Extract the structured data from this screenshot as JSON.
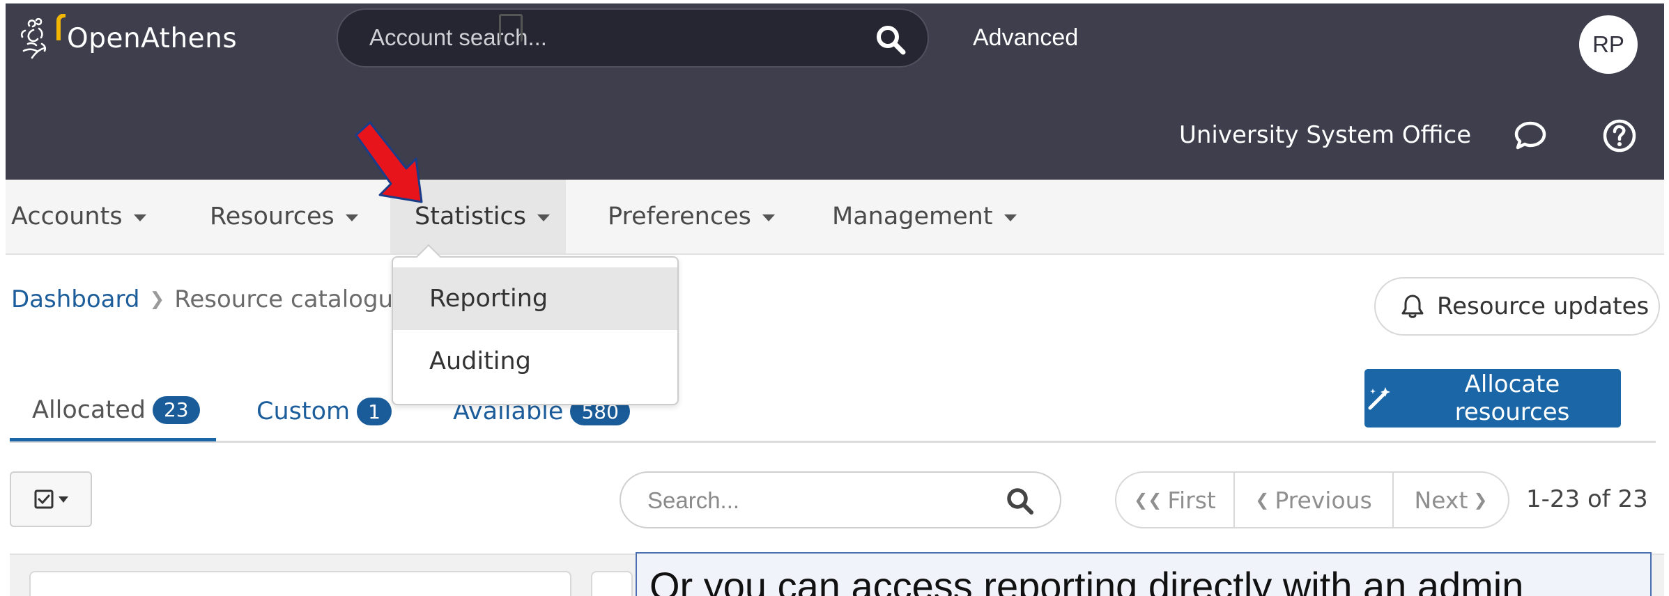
{
  "header": {
    "brand": "OpenAthens",
    "search_placeholder": "Account search...",
    "advanced_label": "Advanced",
    "avatar_initials": "RP",
    "organization": "University System Office"
  },
  "nav": {
    "items": [
      {
        "label": "Accounts"
      },
      {
        "label": "Resources"
      },
      {
        "label": "Statistics"
      },
      {
        "label": "Preferences"
      },
      {
        "label": "Management"
      }
    ],
    "active": "Statistics"
  },
  "statistics_menu": {
    "items": [
      {
        "label": "Reporting"
      },
      {
        "label": "Auditing"
      }
    ]
  },
  "breadcrumb": {
    "home": "Dashboard",
    "current": "Resource catalogue"
  },
  "resource_updates_label": "Resource updates",
  "tabs": [
    {
      "label": "Allocated",
      "count": "23"
    },
    {
      "label": "Custom",
      "count": "1"
    },
    {
      "label": "Available",
      "count": "580"
    }
  ],
  "allocate_label": "Allocate resources",
  "search_placeholder": "Search...",
  "pagination": {
    "first": "First",
    "previous": "Previous",
    "next": "Next",
    "count": "1-23 of 23"
  },
  "callout_text": "Or you can access reporting directly with an admin",
  "colors": {
    "header_bg": "#3e3e4d",
    "primary": "#1a66a6",
    "link": "#1c5d9b",
    "annotation_arrow": "#e8141b"
  }
}
